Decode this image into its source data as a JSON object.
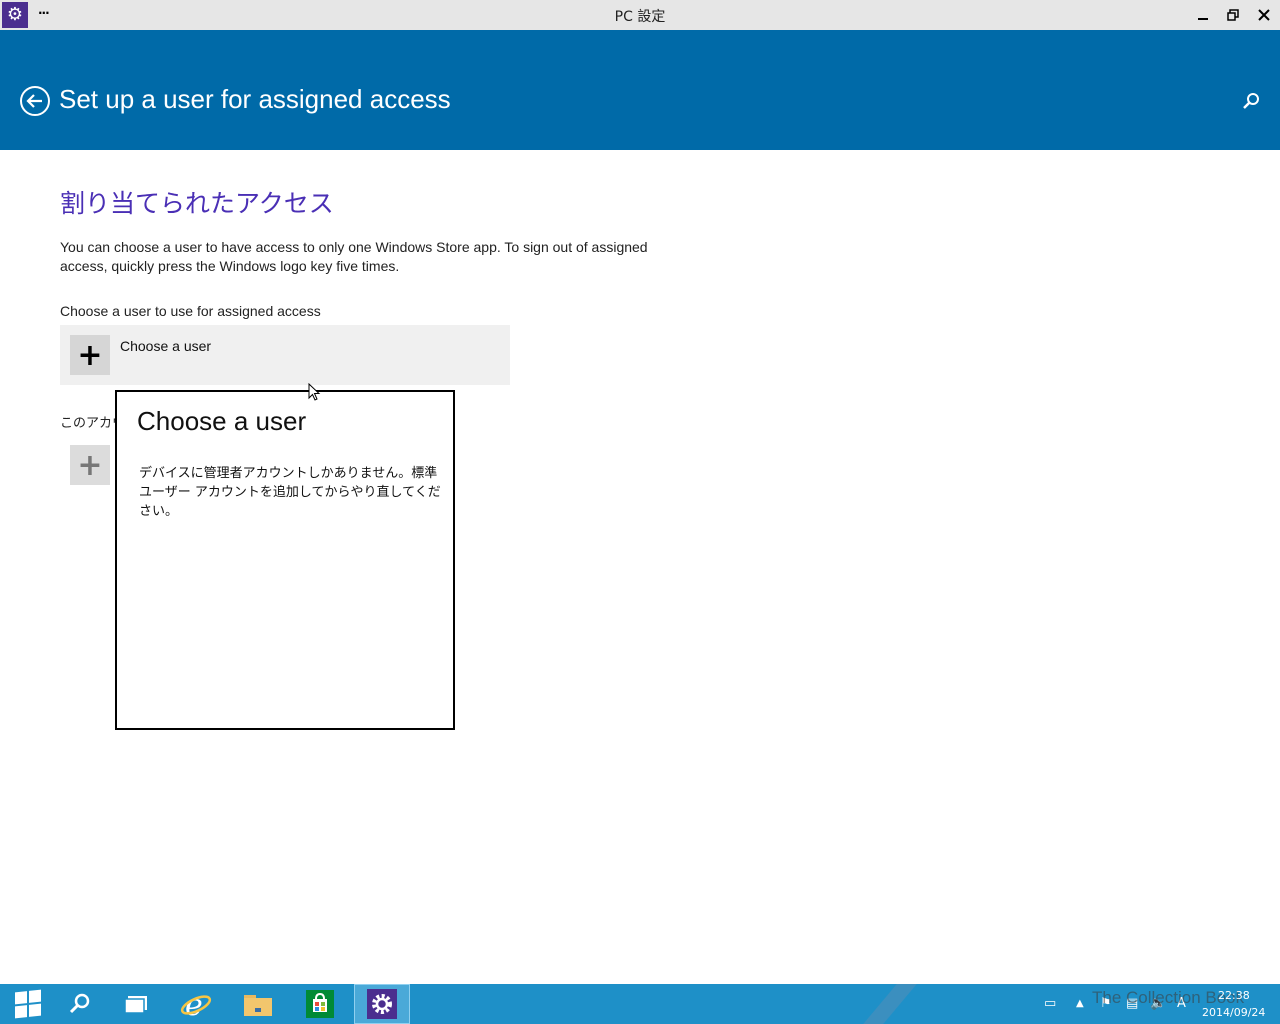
{
  "window": {
    "title": "PC 設定",
    "menu_glyph": "···",
    "app_icon": "gear-icon",
    "minimize_icon": "minimize-icon",
    "restore_icon": "restore-icon",
    "close_icon": "close-icon"
  },
  "header": {
    "title": "Set up a user for assigned access",
    "back_icon": "back-arrow-icon",
    "search_icon": "search-icon",
    "background": "#006aa8"
  },
  "content": {
    "section_heading": "割り当てられたアクセス",
    "description": "You can choose a user to have access to only one Windows Store app. To sign out of assigned access, quickly press the Windows logo key five times.",
    "choose_label": "Choose a user to use for assigned access",
    "choose_user_button": "Choose a user",
    "account_label": "このアカウ"
  },
  "flyout": {
    "title": "Choose a user",
    "message": "デバイスに管理者アカウントしかありません。標準ユーザー アカウントを追加してからやり直してください。"
  },
  "taskbar": {
    "items": [
      {
        "name": "start-icon"
      },
      {
        "name": "search-icon"
      },
      {
        "name": "task-view-icon"
      },
      {
        "name": "internet-explorer-icon"
      },
      {
        "name": "file-explorer-icon"
      },
      {
        "name": "store-icon"
      },
      {
        "name": "settings-icon",
        "active": true
      }
    ],
    "time": "22:38",
    "date": "2014/09/24",
    "ime": "A",
    "watermark": "The Collection Book"
  },
  "colors": {
    "accent_heading": "#4a2fb5",
    "taskbar": "#1e90c8"
  }
}
